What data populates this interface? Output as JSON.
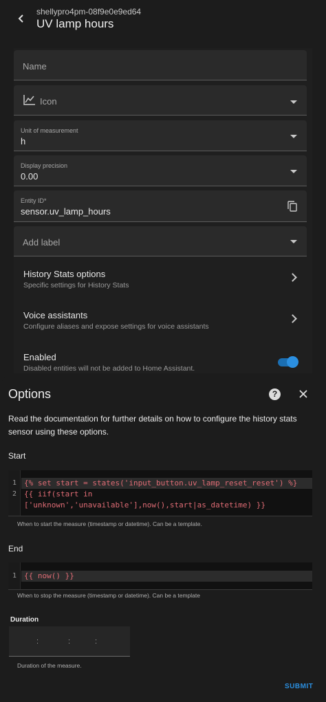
{
  "header": {
    "device": "shellypro4pm-08f9e0e9ed64",
    "title": "UV lamp hours"
  },
  "form": {
    "name_label": "Name",
    "icon_label": "Icon",
    "unit_label": "Unit of measurement",
    "unit_value": "h",
    "precision_label": "Display precision",
    "precision_value": "0.00",
    "entity_label": "Entity ID*",
    "entity_value": "sensor.uv_lamp_hours",
    "add_label": "Add label",
    "history_title": "History Stats options",
    "history_sub": "Specific settings for History Stats",
    "voice_title": "Voice assistants",
    "voice_sub": "Configure aliases and expose settings for voice assistants",
    "enabled_title": "Enabled",
    "enabled_sub": "Disabled entities will not be added to Home Assistant.",
    "enabled": true
  },
  "options": {
    "title": "Options",
    "description": "Read the documentation for further details on how to configure the history stats sensor using these options.",
    "start_label": "Start",
    "start_lines": [
      "{% set start = states('input_button.uv_lamp_reset_reset') %}",
      "{{ iif(start in",
      "['unknown','unavailable'],now(),start|as_datetime) }}"
    ],
    "start_hint": "When to start the measure (timestamp or datetime). Can be a template.",
    "end_label": "End",
    "end_lines": [
      "{{ now() }}"
    ],
    "end_hint": "When to stop the measure (timestamp or datetime). Can be a template",
    "duration_label": "Duration",
    "duration_colons": [
      ":",
      ":",
      ":"
    ],
    "duration_hint": "Duration of the measure.",
    "submit_label": "SUBMIT",
    "line_numbers": [
      "1",
      "2",
      "1"
    ]
  },
  "colors": {
    "accent": "#2b8fe0",
    "background": "#1c1c1c"
  }
}
